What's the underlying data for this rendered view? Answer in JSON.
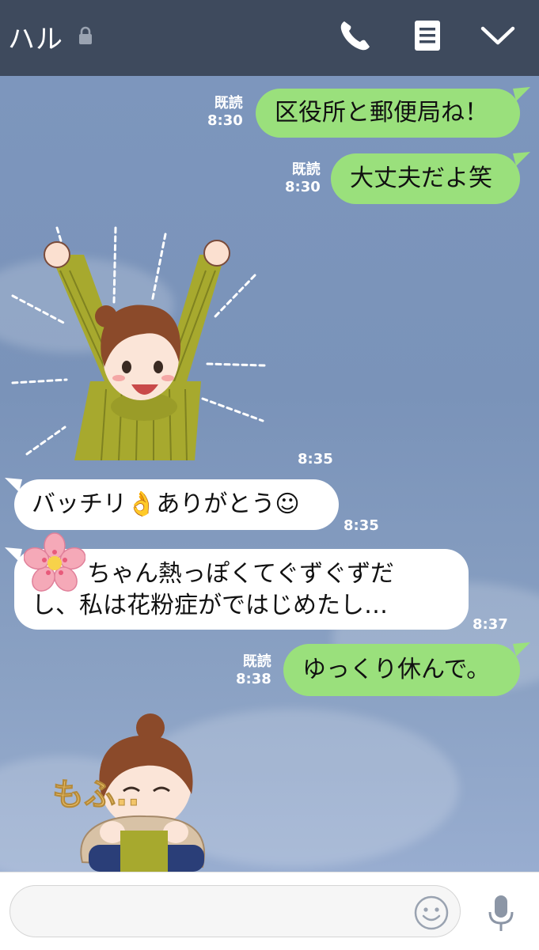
{
  "header": {
    "contact_name": "ハル"
  },
  "messages": [
    {
      "side": "right",
      "type": "text",
      "text": "区役所と郵便局ね！",
      "read": "既読",
      "time": "8:30"
    },
    {
      "side": "right",
      "type": "text",
      "text": "大丈夫だよ笑",
      "read": "既読",
      "time": "8:30"
    },
    {
      "side": "left",
      "type": "sticker",
      "sticker": "girl-cheering-arms-up",
      "time": "8:35"
    },
    {
      "side": "left",
      "type": "text",
      "text": "バッチリ👌ありがとう☺",
      "time": "8:35"
    },
    {
      "side": "left",
      "type": "text",
      "line1": "ちゃん熱っぽくてぐずぐずだ",
      "line2": "し、私は花粉症がではじめたし…",
      "time": "8:37"
    },
    {
      "side": "right",
      "type": "text",
      "text": "ゆっくり休んで。",
      "read": "既読",
      "time": "8:38"
    },
    {
      "side": "left",
      "type": "sticker",
      "sticker": "girl-hugging-fluffy"
    }
  ],
  "sticker_text": {
    "mofu": "もふ.."
  },
  "icons": {
    "lock": "lock-icon",
    "call": "phone-icon",
    "notes": "notes-icon",
    "menu": "chevron-down-icon",
    "emoji": "smiley-icon",
    "mic": "microphone-icon"
  },
  "colors": {
    "header": "#3e4a5d",
    "bubble_mine": "#9ae07c",
    "bubble_theirs": "#ffffff",
    "background": "#7d96bd"
  }
}
